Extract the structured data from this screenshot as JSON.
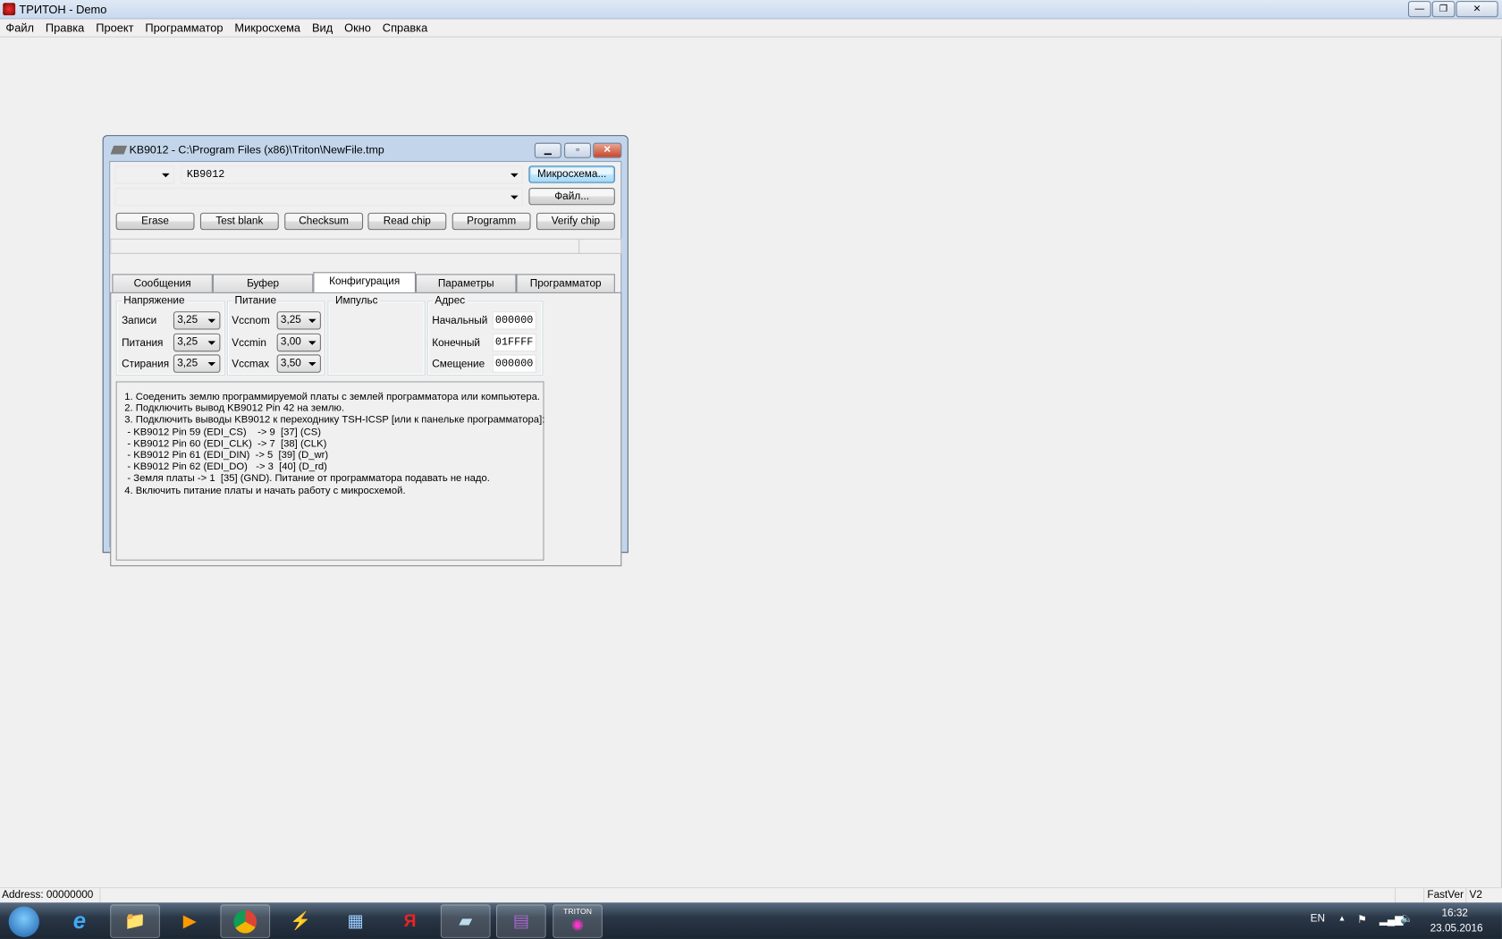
{
  "app": {
    "title": "ТРИТОН - Demo",
    "menu": [
      "Файл",
      "Правка",
      "Проект",
      "Программатор",
      "Микросхема",
      "Вид",
      "Окно",
      "Справка"
    ]
  },
  "window": {
    "title": "KB9012 - C:\\Program Files (x86)\\Triton\\NewFile.tmp",
    "chip_value": "KB9012",
    "small_combo_value": "",
    "file_combo_value": "",
    "chip_button": "Микросхема...",
    "file_button": "Файл...",
    "actions": [
      "Erase",
      "Test  blank",
      "Checksum",
      "Read  chip",
      "Programm",
      "Verify  chip"
    ],
    "tabs": [
      "Сообщения",
      "Буфер",
      "Конфигурация",
      "Параметры",
      "Программатор"
    ],
    "active_tab": "Конфигурация"
  },
  "config": {
    "voltage": {
      "legend": "Напряжение",
      "rows": [
        {
          "label": "Записи",
          "value": "3,25"
        },
        {
          "label": "Питания",
          "value": "3,25"
        },
        {
          "label": "Стирания",
          "value": "3,25"
        }
      ]
    },
    "power": {
      "legend": "Питание",
      "rows": [
        {
          "label": "Vccnom",
          "value": "3,25"
        },
        {
          "label": "Vccmin",
          "value": "3,00"
        },
        {
          "label": "Vccmax",
          "value": "3,50"
        }
      ]
    },
    "pulse": {
      "legend": "Импульс"
    },
    "address": {
      "legend": "Адрес",
      "rows": [
        {
          "label": "Начальный",
          "value": "000000"
        },
        {
          "label": "Конечный",
          "value": "01FFFF"
        },
        {
          "label": "Смещение",
          "value": "000000"
        }
      ]
    },
    "notes": "1. Соеденить землю программируемой платы с землей программатора или компьютера.\n2. Подключить вывод KB9012 Pin 42 на землю.\n3. Подключить выводы KB9012 к переходнику TSH-ICSP [или к панельке программатора]:\n - KB9012 Pin 59 (EDI_CS)    -> 9  [37] (CS)\n - KB9012 Pin 60 (EDI_CLK)  -> 7  [38] (CLK)\n - KB9012 Pin 61 (EDI_DIN)  -> 5  [39] (D_wr)\n - KB9012 Pin 62 (EDI_DO)   -> 3  [40] (D_rd)\n - Земля платы -> 1  [35] (GND). Питание от программатора подавать не надо.\n4. Включить питание платы и начать работу с микросхемой."
  },
  "status": {
    "address": "Address: 00000000",
    "fastver": "FastVer",
    "v2": "V2"
  },
  "taskbar": {
    "triton_label": "TRITON",
    "lang": "EN",
    "time": "16:32",
    "date": "23.05.2016"
  }
}
